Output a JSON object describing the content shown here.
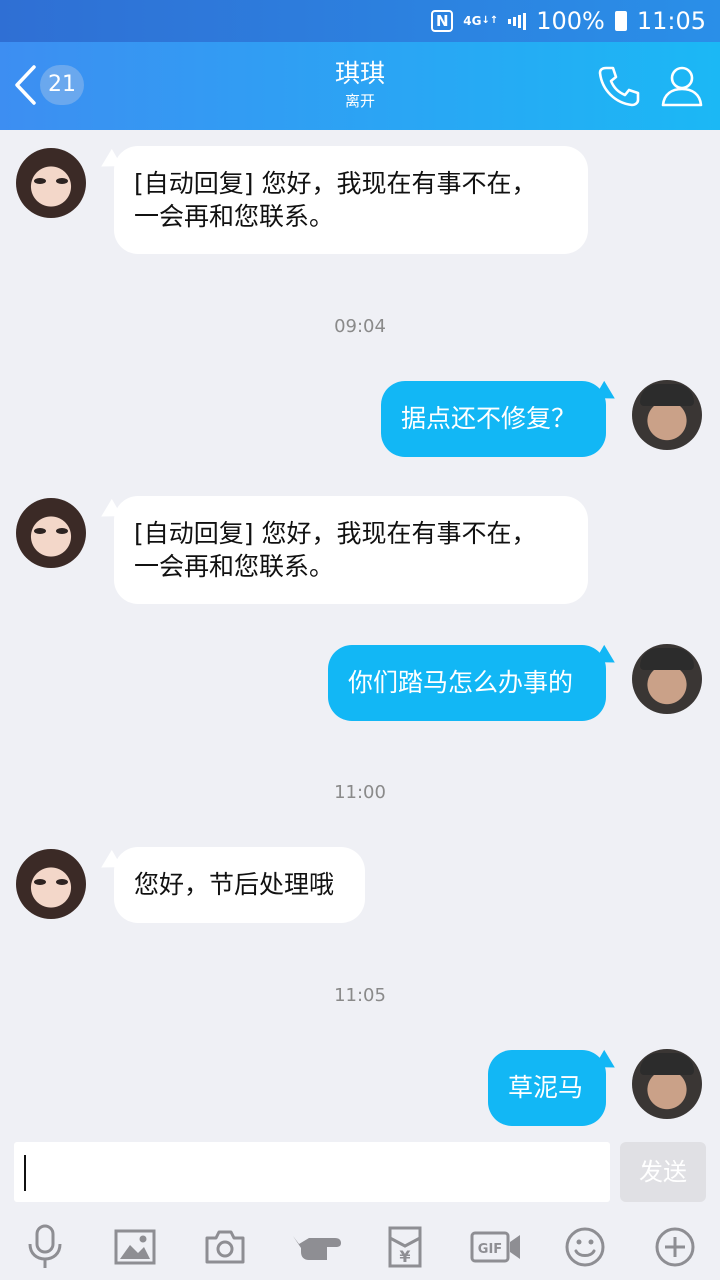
{
  "status_bar": {
    "nfc": "N",
    "network": "4G",
    "battery": "100%",
    "time": "11:05"
  },
  "header": {
    "unread_count": "21",
    "contact_name": "琪琪",
    "contact_status": "离开"
  },
  "messages": [
    {
      "from": "contact",
      "text": "[自动回复] 您好，我现在有事不在，\n一会再和您联系。"
    },
    {
      "type": "time",
      "text": "09:04"
    },
    {
      "from": "me",
      "text": "据点还不修复？"
    },
    {
      "from": "contact",
      "text": "[自动回复] 您好，我现在有事不在，\n一会再和您联系。"
    },
    {
      "from": "me",
      "text": "你们踏马怎么办事的"
    },
    {
      "type": "time",
      "text": "11:00"
    },
    {
      "from": "contact",
      "text": "您好，节后处理哦"
    },
    {
      "type": "time",
      "text": "11:05"
    },
    {
      "from": "me",
      "text": "草泥马"
    }
  ],
  "input": {
    "value": "",
    "send_label": "发送"
  },
  "toolbar": {
    "icons": [
      "microphone-icon",
      "image-icon",
      "camera-icon",
      "poke-icon",
      "red-packet-icon",
      "gif-icon",
      "emoji-icon",
      "plus-icon"
    ],
    "gif_label": "GIF",
    "red_packet_symbol": "¥"
  },
  "colors": {
    "accent": "#12b7f5",
    "header_start": "#3d8ef2",
    "header_end": "#1bb8f5",
    "background": "#eff0f5"
  }
}
